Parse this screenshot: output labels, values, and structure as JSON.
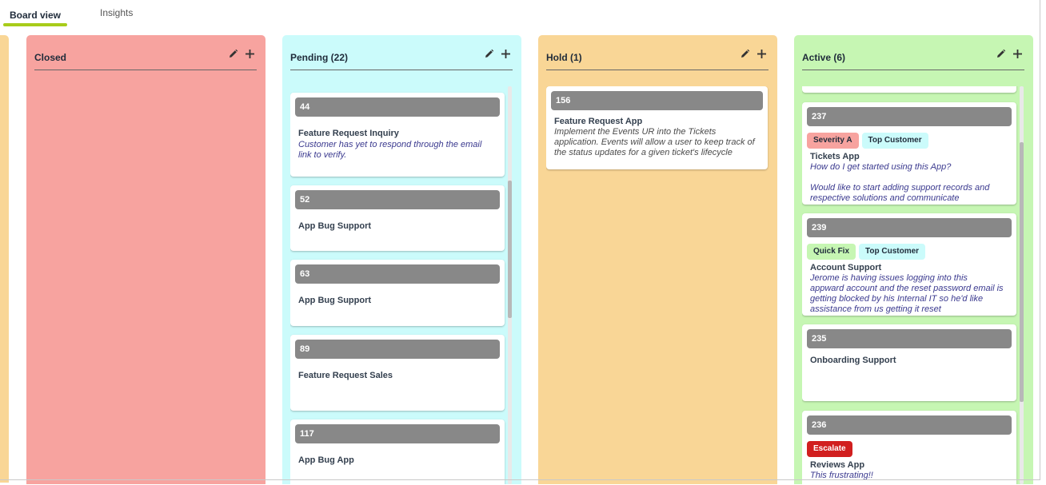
{
  "tabs": {
    "board": "Board view",
    "insights": "Insights"
  },
  "colors": {
    "closed": "#f7a39f",
    "pending": "#cbfbfb",
    "hold": "#f9d696",
    "active": "#c6f6b3",
    "accent": "#a8cc1a",
    "card_id_bar": "#888888",
    "escalate": "#d11f1f"
  },
  "icons": {
    "edit": "pencil-icon",
    "add": "plus-icon"
  },
  "columns": {
    "closed": {
      "title": "Closed"
    },
    "pending": {
      "title": "Pending (22)",
      "cards": [
        {
          "id": "44",
          "title": "Feature Request Inquiry",
          "desc": "Customer has yet to respond through the email link to verify."
        },
        {
          "id": "52",
          "title": "App Bug Support"
        },
        {
          "id": "63",
          "title": "App Bug Support"
        },
        {
          "id": "89",
          "title": "Feature Request Sales"
        },
        {
          "id": "117",
          "title": "App Bug App"
        }
      ]
    },
    "hold": {
      "title": "Hold (1)",
      "cards": [
        {
          "id": "156",
          "title": "Feature Request App",
          "desc": "Implement the Events UR into the Tickets application. Events will allow a user to keep track of the status updates for a given ticket's lifecycle"
        }
      ]
    },
    "active": {
      "title": "Active (6)",
      "cards": [
        {
          "id": "237",
          "tags": [
            "Severity A",
            "Top Customer"
          ],
          "title": "Tickets App",
          "desc": "How do I get started using this App?",
          "desc2": "Would like to start adding support records and respective solutions and communicate"
        },
        {
          "id": "239",
          "tags": [
            "Quick Fix",
            "Top Customer"
          ],
          "title": "Account Support",
          "desc": "Jerome is having issues logging into this appward account and the reset password email is getting blocked by his Internal IT so he'd like assistance from us getting it reset"
        },
        {
          "id": "235",
          "title": "Onboarding Support"
        },
        {
          "id": "236",
          "tags": [
            "Escalate"
          ],
          "title": "Reviews App",
          "desc": "This frustrating!!"
        }
      ]
    }
  }
}
